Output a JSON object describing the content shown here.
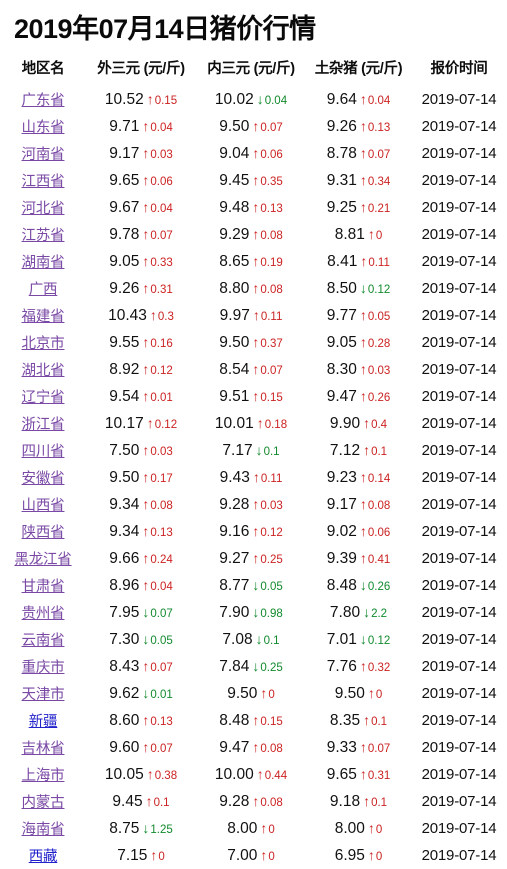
{
  "page": {
    "title": "2019年07月14日猪价行情",
    "accent_up_color": "#cc2222",
    "accent_down_color": "#128a2e",
    "link_visited_color": "#7a49a5",
    "link_color": "#2222cc",
    "background_color": "#ffffff"
  },
  "table": {
    "headers": [
      "地区名",
      "外三元 (元/斤)",
      "内三元 (元/斤)",
      "土杂猪 (元/斤)",
      "报价时间"
    ],
    "icons": {
      "up": "↑",
      "down": "↓"
    },
    "rows": [
      {
        "region": "广东省",
        "link_state": "visited",
        "wai": {
          "value": "10.52",
          "dir": "up",
          "delta": "0.15"
        },
        "nei": {
          "value": "10.02",
          "dir": "down",
          "delta": "0.04"
        },
        "tu": {
          "value": "9.64",
          "dir": "up",
          "delta": "0.04"
        },
        "date": "2019-07-14"
      },
      {
        "region": "山东省",
        "link_state": "visited",
        "wai": {
          "value": "9.71",
          "dir": "up",
          "delta": "0.04"
        },
        "nei": {
          "value": "9.50",
          "dir": "up",
          "delta": "0.07"
        },
        "tu": {
          "value": "9.26",
          "dir": "up",
          "delta": "0.13"
        },
        "date": "2019-07-14"
      },
      {
        "region": "河南省",
        "link_state": "visited",
        "wai": {
          "value": "9.17",
          "dir": "up",
          "delta": "0.03"
        },
        "nei": {
          "value": "9.04",
          "dir": "up",
          "delta": "0.06"
        },
        "tu": {
          "value": "8.78",
          "dir": "up",
          "delta": "0.07"
        },
        "date": "2019-07-14"
      },
      {
        "region": "江西省",
        "link_state": "visited",
        "wai": {
          "value": "9.65",
          "dir": "up",
          "delta": "0.06"
        },
        "nei": {
          "value": "9.45",
          "dir": "up",
          "delta": "0.35"
        },
        "tu": {
          "value": "9.31",
          "dir": "up",
          "delta": "0.34"
        },
        "date": "2019-07-14"
      },
      {
        "region": "河北省",
        "link_state": "visited",
        "wai": {
          "value": "9.67",
          "dir": "up",
          "delta": "0.04"
        },
        "nei": {
          "value": "9.48",
          "dir": "up",
          "delta": "0.13"
        },
        "tu": {
          "value": "9.25",
          "dir": "up",
          "delta": "0.21"
        },
        "date": "2019-07-14"
      },
      {
        "region": "江苏省",
        "link_state": "visited",
        "wai": {
          "value": "9.78",
          "dir": "up",
          "delta": "0.07"
        },
        "nei": {
          "value": "9.29",
          "dir": "up",
          "delta": "0.08"
        },
        "tu": {
          "value": "8.81",
          "dir": "up",
          "delta": "0"
        },
        "date": "2019-07-14"
      },
      {
        "region": "湖南省",
        "link_state": "visited",
        "wai": {
          "value": "9.05",
          "dir": "up",
          "delta": "0.33"
        },
        "nei": {
          "value": "8.65",
          "dir": "up",
          "delta": "0.19"
        },
        "tu": {
          "value": "8.41",
          "dir": "up",
          "delta": "0.11"
        },
        "date": "2019-07-14"
      },
      {
        "region": "广西",
        "link_state": "visited",
        "wai": {
          "value": "9.26",
          "dir": "up",
          "delta": "0.31"
        },
        "nei": {
          "value": "8.80",
          "dir": "up",
          "delta": "0.08"
        },
        "tu": {
          "value": "8.50",
          "dir": "down",
          "delta": "0.12"
        },
        "date": "2019-07-14"
      },
      {
        "region": "福建省",
        "link_state": "visited",
        "wai": {
          "value": "10.43",
          "dir": "up",
          "delta": "0.3"
        },
        "nei": {
          "value": "9.97",
          "dir": "up",
          "delta": "0.11"
        },
        "tu": {
          "value": "9.77",
          "dir": "up",
          "delta": "0.05"
        },
        "date": "2019-07-14"
      },
      {
        "region": "北京市",
        "link_state": "visited",
        "wai": {
          "value": "9.55",
          "dir": "up",
          "delta": "0.16"
        },
        "nei": {
          "value": "9.50",
          "dir": "up",
          "delta": "0.37"
        },
        "tu": {
          "value": "9.05",
          "dir": "up",
          "delta": "0.28"
        },
        "date": "2019-07-14"
      },
      {
        "region": "湖北省",
        "link_state": "visited",
        "wai": {
          "value": "8.92",
          "dir": "up",
          "delta": "0.12"
        },
        "nei": {
          "value": "8.54",
          "dir": "up",
          "delta": "0.07"
        },
        "tu": {
          "value": "8.30",
          "dir": "up",
          "delta": "0.03"
        },
        "date": "2019-07-14"
      },
      {
        "region": "辽宁省",
        "link_state": "visited",
        "wai": {
          "value": "9.54",
          "dir": "up",
          "delta": "0.01"
        },
        "nei": {
          "value": "9.51",
          "dir": "up",
          "delta": "0.15"
        },
        "tu": {
          "value": "9.47",
          "dir": "up",
          "delta": "0.26"
        },
        "date": "2019-07-14"
      },
      {
        "region": "浙江省",
        "link_state": "visited",
        "wai": {
          "value": "10.17",
          "dir": "up",
          "delta": "0.12"
        },
        "nei": {
          "value": "10.01",
          "dir": "up",
          "delta": "0.18"
        },
        "tu": {
          "value": "9.90",
          "dir": "up",
          "delta": "0.4"
        },
        "date": "2019-07-14"
      },
      {
        "region": "四川省",
        "link_state": "visited",
        "wai": {
          "value": "7.50",
          "dir": "up",
          "delta": "0.03"
        },
        "nei": {
          "value": "7.17",
          "dir": "down",
          "delta": "0.1"
        },
        "tu": {
          "value": "7.12",
          "dir": "up",
          "delta": "0.1"
        },
        "date": "2019-07-14"
      },
      {
        "region": "安徽省",
        "link_state": "visited",
        "wai": {
          "value": "9.50",
          "dir": "up",
          "delta": "0.17"
        },
        "nei": {
          "value": "9.43",
          "dir": "up",
          "delta": "0.11"
        },
        "tu": {
          "value": "9.23",
          "dir": "up",
          "delta": "0.14"
        },
        "date": "2019-07-14"
      },
      {
        "region": "山西省",
        "link_state": "visited",
        "wai": {
          "value": "9.34",
          "dir": "up",
          "delta": "0.08"
        },
        "nei": {
          "value": "9.28",
          "dir": "up",
          "delta": "0.03"
        },
        "tu": {
          "value": "9.17",
          "dir": "up",
          "delta": "0.08"
        },
        "date": "2019-07-14"
      },
      {
        "region": "陕西省",
        "link_state": "visited",
        "wai": {
          "value": "9.34",
          "dir": "up",
          "delta": "0.13"
        },
        "nei": {
          "value": "9.16",
          "dir": "up",
          "delta": "0.12"
        },
        "tu": {
          "value": "9.02",
          "dir": "up",
          "delta": "0.06"
        },
        "date": "2019-07-14"
      },
      {
        "region": "黑龙江省",
        "link_state": "visited",
        "wai": {
          "value": "9.66",
          "dir": "up",
          "delta": "0.24"
        },
        "nei": {
          "value": "9.27",
          "dir": "up",
          "delta": "0.25"
        },
        "tu": {
          "value": "9.39",
          "dir": "up",
          "delta": "0.41"
        },
        "date": "2019-07-14"
      },
      {
        "region": "甘肃省",
        "link_state": "visited",
        "wai": {
          "value": "8.96",
          "dir": "up",
          "delta": "0.04"
        },
        "nei": {
          "value": "8.77",
          "dir": "down",
          "delta": "0.05"
        },
        "tu": {
          "value": "8.48",
          "dir": "down",
          "delta": "0.26"
        },
        "date": "2019-07-14"
      },
      {
        "region": "贵州省",
        "link_state": "visited",
        "wai": {
          "value": "7.95",
          "dir": "down",
          "delta": "0.07"
        },
        "nei": {
          "value": "7.90",
          "dir": "down",
          "delta": "0.98"
        },
        "tu": {
          "value": "7.80",
          "dir": "down",
          "delta": "2.2"
        },
        "date": "2019-07-14"
      },
      {
        "region": "云南省",
        "link_state": "visited",
        "wai": {
          "value": "7.30",
          "dir": "down",
          "delta": "0.05"
        },
        "nei": {
          "value": "7.08",
          "dir": "down",
          "delta": "0.1"
        },
        "tu": {
          "value": "7.01",
          "dir": "down",
          "delta": "0.12"
        },
        "date": "2019-07-14"
      },
      {
        "region": "重庆市",
        "link_state": "visited",
        "wai": {
          "value": "8.43",
          "dir": "up",
          "delta": "0.07"
        },
        "nei": {
          "value": "7.84",
          "dir": "down",
          "delta": "0.25"
        },
        "tu": {
          "value": "7.76",
          "dir": "up",
          "delta": "0.32"
        },
        "date": "2019-07-14"
      },
      {
        "region": "天津市",
        "link_state": "visited",
        "wai": {
          "value": "9.62",
          "dir": "down",
          "delta": "0.01"
        },
        "nei": {
          "value": "9.50",
          "dir": "up",
          "delta": "0"
        },
        "tu": {
          "value": "9.50",
          "dir": "up",
          "delta": "0"
        },
        "date": "2019-07-14"
      },
      {
        "region": "新疆",
        "link_state": "normal",
        "wai": {
          "value": "8.60",
          "dir": "up",
          "delta": "0.13"
        },
        "nei": {
          "value": "8.48",
          "dir": "up",
          "delta": "0.15"
        },
        "tu": {
          "value": "8.35",
          "dir": "up",
          "delta": "0.1"
        },
        "date": "2019-07-14"
      },
      {
        "region": "吉林省",
        "link_state": "visited",
        "wai": {
          "value": "9.60",
          "dir": "up",
          "delta": "0.07"
        },
        "nei": {
          "value": "9.47",
          "dir": "up",
          "delta": "0.08"
        },
        "tu": {
          "value": "9.33",
          "dir": "up",
          "delta": "0.07"
        },
        "date": "2019-07-14"
      },
      {
        "region": "上海市",
        "link_state": "visited",
        "wai": {
          "value": "10.05",
          "dir": "up",
          "delta": "0.38"
        },
        "nei": {
          "value": "10.00",
          "dir": "up",
          "delta": "0.44"
        },
        "tu": {
          "value": "9.65",
          "dir": "up",
          "delta": "0.31"
        },
        "date": "2019-07-14"
      },
      {
        "region": "内蒙古",
        "link_state": "visited",
        "wai": {
          "value": "9.45",
          "dir": "up",
          "delta": "0.1"
        },
        "nei": {
          "value": "9.28",
          "dir": "up",
          "delta": "0.08"
        },
        "tu": {
          "value": "9.18",
          "dir": "up",
          "delta": "0.1"
        },
        "date": "2019-07-14"
      },
      {
        "region": "海南省",
        "link_state": "visited",
        "wai": {
          "value": "8.75",
          "dir": "down",
          "delta": "1.25"
        },
        "nei": {
          "value": "8.00",
          "dir": "up",
          "delta": "0"
        },
        "tu": {
          "value": "8.00",
          "dir": "up",
          "delta": "0"
        },
        "date": "2019-07-14"
      },
      {
        "region": "西藏",
        "link_state": "normal",
        "wai": {
          "value": "7.15",
          "dir": "up",
          "delta": "0"
        },
        "nei": {
          "value": "7.00",
          "dir": "up",
          "delta": "0"
        },
        "tu": {
          "value": "6.95",
          "dir": "up",
          "delta": "0"
        },
        "date": "2019-07-14"
      }
    ]
  }
}
